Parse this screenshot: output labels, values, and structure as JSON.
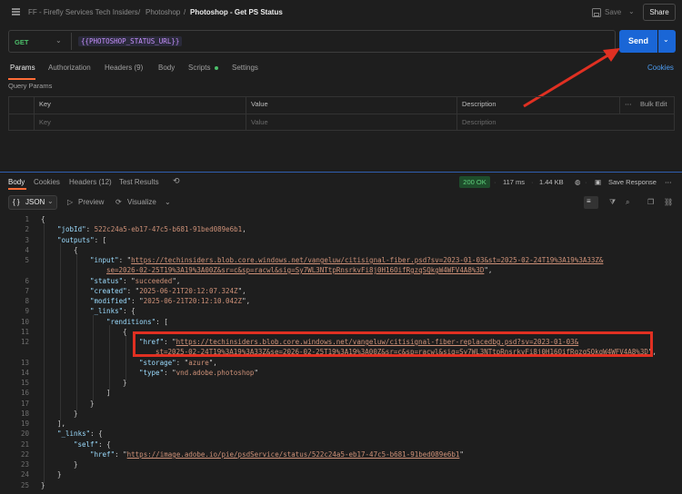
{
  "breadcrumb": {
    "workspace": "FF - Firefly Services Tech Insiders",
    "collection": "Photoshop",
    "request": "Photoshop - Get PS Status"
  },
  "toolbar": {
    "save_label": "Save",
    "share_label": "Share"
  },
  "request": {
    "method": "GET",
    "url": "{{PHOTOSHOP_STATUS_URL}}",
    "send_label": "Send",
    "tabs": [
      "Params",
      "Authorization",
      "Headers (9)",
      "Body",
      "Scripts",
      "Settings"
    ],
    "cookies_label": "Cookies"
  },
  "params": {
    "section_label": "Query Params",
    "headers": [
      "Key",
      "Value",
      "Description"
    ],
    "bulk_edit": "Bulk Edit",
    "placeholders": [
      "Key",
      "Value",
      "Description"
    ]
  },
  "response": {
    "tabs": [
      "Body",
      "Cookies",
      "Headers (12)",
      "Test Results"
    ],
    "status": "200 OK",
    "time": "117 ms",
    "size": "1.44 KB",
    "save_response": "Save Response",
    "format": "JSON",
    "preview": "Preview",
    "visualize": "Visualize"
  },
  "json": {
    "jobId": "522c24a5-eb17-47c5-b681-91bed089e6b1",
    "input_url_1": "https://techinsiders.blob.core.windows.net/vangeluw/citisignal-fiber.psd?sv=2023-01-03&st=2025-02-24T19%3A19%3A33Z&",
    "input_url_2": "se=2026-02-25T19%3A19%3A00Z&sr=c&sp=racwl&sig=Sy7WL3NTtpRnsrkvFi8j0H16OifRgzqSQkgW4WFV4A8%3D",
    "status": "succeeded",
    "created": "2025-06-21T20:12:07.324Z",
    "modified": "2025-06-21T20:12:10.042Z",
    "href_url_1": "https://techinsiders.blob.core.windows.net/vangeluw/citisignal-fiber-replacedbg.psd?sv=2023-01-03&",
    "href_url_2": "st=2025-02-24T19%3A19%3A33Z&se=2026-02-25T19%3A19%3A00Z&sr=c&sp=racwl&sig=Sy7WL3NTtpRnsrkvFi8j0H16OifRgzqSQkgW4WFV4A8%3D",
    "storage": "azure",
    "type": "vnd.adobe.photoshop",
    "self_href": "https://image.adobe.io/pie/psdService/status/522c24a5-eb17-47c5-b681-91bed089e6b1"
  },
  "line_numbers": [
    "1",
    "2",
    "3",
    "4",
    "5",
    "6",
    "7",
    "8",
    "9",
    "10",
    "11",
    "12",
    "13",
    "14",
    "15",
    "16",
    "17",
    "18",
    "19",
    "20",
    "21",
    "22",
    "23",
    "24",
    "25"
  ],
  "colors": {
    "accent": "#ff6c37",
    "send": "#1a66d6",
    "highlight": "#e03022",
    "ok": "#5fd07c"
  }
}
